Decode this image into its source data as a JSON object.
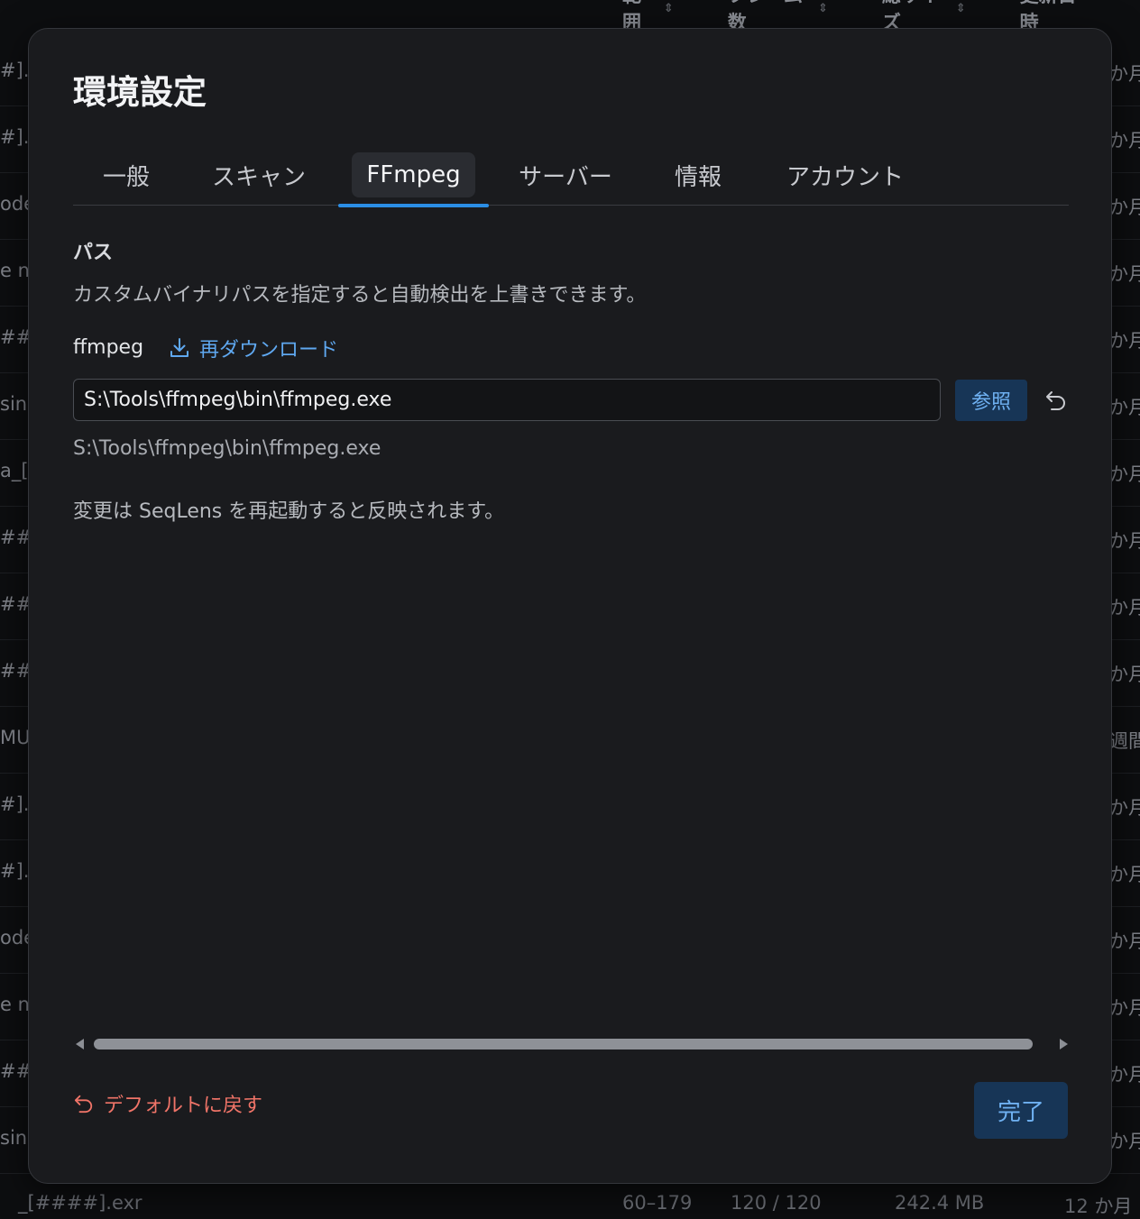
{
  "background": {
    "columns": [
      {
        "label": "範囲"
      },
      {
        "label": "フレーム数"
      },
      {
        "label": "総サイズ"
      },
      {
        "label": "更新日時"
      }
    ],
    "rows": [
      {
        "left": "#].e",
        "right": "か月"
      },
      {
        "left": "#].e",
        "right": "か月"
      },
      {
        "left": "ode",
        "right": "か月"
      },
      {
        "left": "e n",
        "right": "か月"
      },
      {
        "left": "##].",
        "right": "か月"
      },
      {
        "left": "sing",
        "right": "か月"
      },
      {
        "left": "a_[",
        "right": "か月"
      },
      {
        "left": "####",
        "right": "か月"
      },
      {
        "left": "####",
        "right": "か月"
      },
      {
        "left": "##].",
        "right": "か月"
      },
      {
        "left": "MUI",
        "right": "週間前"
      },
      {
        "left": "#].e",
        "right": "か月"
      },
      {
        "left": "#].e",
        "right": "か月"
      },
      {
        "left": "ode",
        "right": "か月"
      },
      {
        "left": "e n",
        "right": "か月"
      },
      {
        "left": "##].",
        "right": "か月"
      },
      {
        "left": "sing",
        "right": "か月"
      }
    ],
    "footer_row": {
      "name": "_[####].exr",
      "range": "60–179",
      "frames": "120 / 120",
      "size": "242.4 MB",
      "updated": "12 か月"
    }
  },
  "modal": {
    "title": "環境設定",
    "tabs": [
      {
        "label": "一般"
      },
      {
        "label": "スキャン"
      },
      {
        "label": "FFmpeg"
      },
      {
        "label": "サーバー"
      },
      {
        "label": "情報"
      },
      {
        "label": "アカウント"
      }
    ],
    "active_tab": "FFmpeg",
    "section": {
      "title": "パス",
      "description": "カスタムバイナリパスを指定すると自動検出を上書きできます。"
    },
    "ffmpeg": {
      "label": "ffmpeg",
      "redownload_label": "再ダウンロード",
      "path_value": "S:\\Tools\\ffmpeg\\bin\\ffmpeg.exe",
      "browse_label": "参照",
      "resolved_path": "S:\\Tools\\ffmpeg\\bin\\ffmpeg.exe"
    },
    "restart_note": "変更は SeqLens を再起動すると反映されます。",
    "reset_default_label": "デフォルトに戻す",
    "done_label": "完了"
  },
  "colors": {
    "accent": "#2b8ee6",
    "link": "#5fa8f0",
    "danger": "#f07468",
    "button_bg": "#173556",
    "modal_bg": "#1a1b1e"
  },
  "icons": {
    "redownload": "download-icon",
    "reset_field": "undo-icon",
    "reset_default": "undo-icon"
  }
}
